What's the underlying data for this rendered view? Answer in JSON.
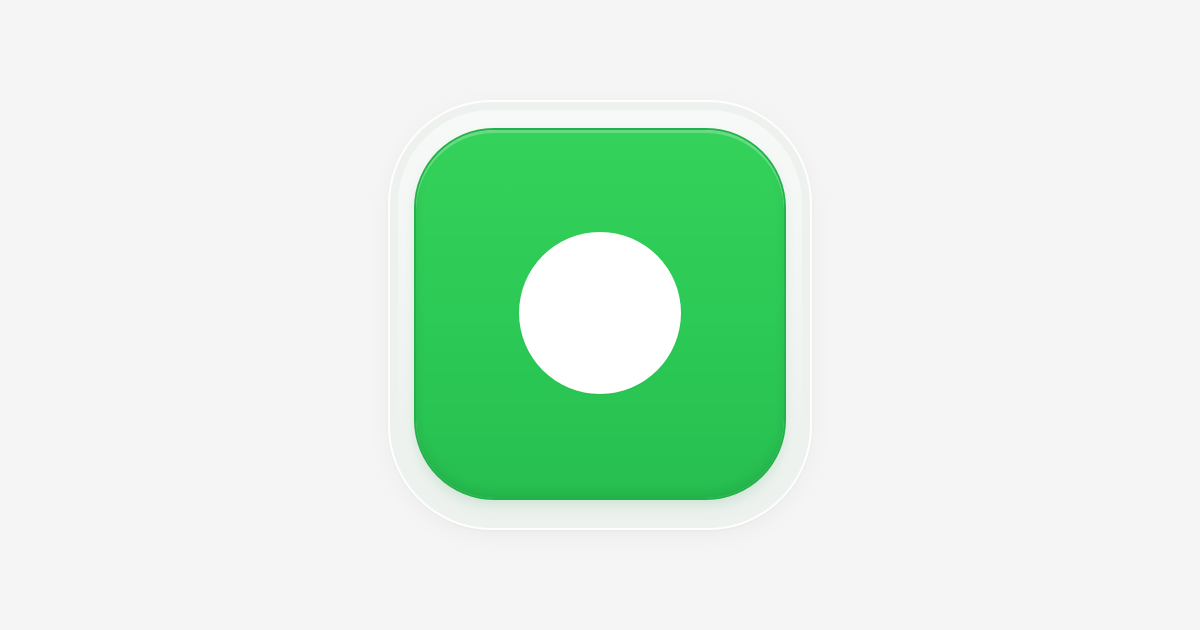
{
  "app_icon": {
    "name": "record-app-icon",
    "colors": {
      "background": "#f5f5f5",
      "outer_plate": "#eef2ef",
      "button_green": "#2cca56",
      "button_border": "#22b14a",
      "dot": "#ffffff"
    },
    "glyph": "record-dot-icon"
  }
}
